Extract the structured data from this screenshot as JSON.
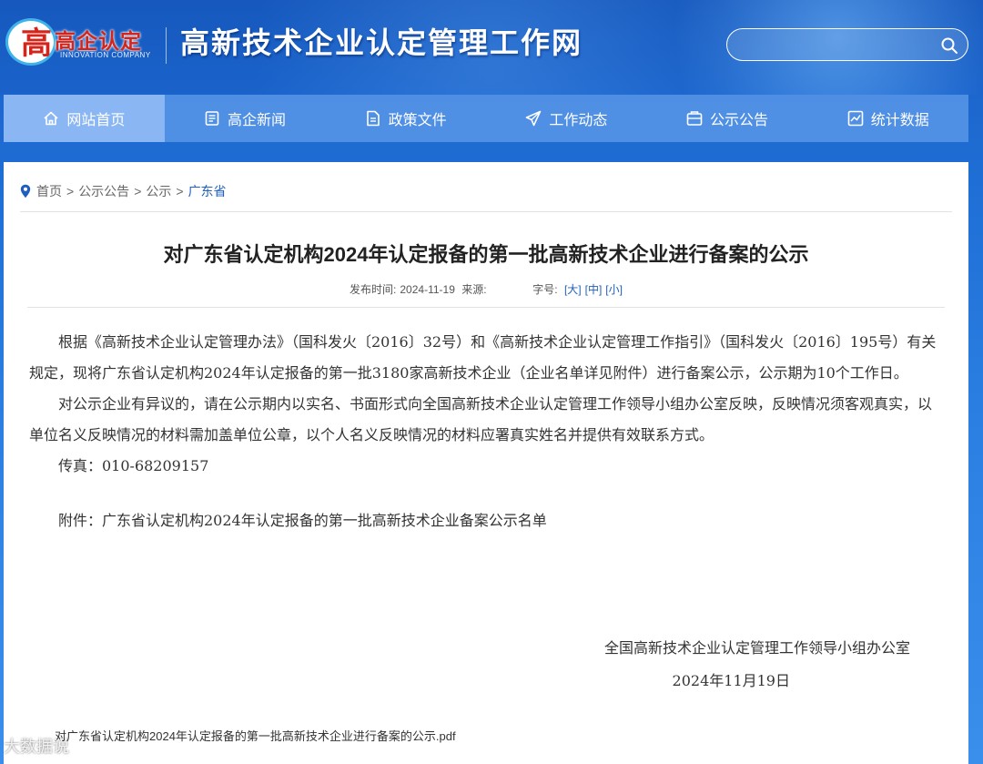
{
  "logo": {
    "cn": "高企认定",
    "en": "INNOVATION COMPANY",
    "mark": "高"
  },
  "site_title": "高新技术企业认定管理工作网",
  "search": {
    "placeholder": ""
  },
  "nav": [
    {
      "label": "网站首页",
      "icon": "home-icon"
    },
    {
      "label": "高企新闻",
      "icon": "news-icon"
    },
    {
      "label": "政策文件",
      "icon": "document-icon"
    },
    {
      "label": "工作动态",
      "icon": "send-icon"
    },
    {
      "label": "公示公告",
      "icon": "notice-icon"
    },
    {
      "label": "统计数据",
      "icon": "chart-icon"
    }
  ],
  "breadcrumb": {
    "home": "首页",
    "level1": "公示公告",
    "level2": "公示",
    "current": "广东省",
    "sep": ">"
  },
  "article": {
    "title": "对广东省认定机构2024年认定报备的第一批高新技术企业进行备案的公示",
    "publish_label": "发布时间:",
    "publish_date": "2024-11-19",
    "source_label": "来源:",
    "font_label": "字号:",
    "font_large": "[大]",
    "font_medium": "[中]",
    "font_small": "[小]",
    "paragraphs": [
      "根据《高新技术企业认定管理办法》（国科发火〔2016〕32号）和《高新技术企业认定管理工作指引》（国科发火〔2016〕195号）有关规定，现将广东省认定机构2024年认定报备的第一批3180家高新技术企业（企业名单详见附件）进行备案公示，公示期为10个工作日。",
      "对公示企业有异议的，请在公示期内以实名、书面形式向全国高新技术企业认定管理工作领导小组办公室反映，反映情况须客观真实，以单位名义反映情况的材料需加盖单位公章，以个人名义反映情况的材料应署真实姓名并提供有效联系方式。",
      "传真：010-68209157"
    ],
    "attachment_note": "附件：广东省认定机构2024年认定报备的第一批高新技术企业备案公示名单",
    "signature": "全国高新技术企业认定管理工作领导小组办公室",
    "signature_date": "2024年11月19日",
    "attachment_file": "对广东省认定机构2024年认定报备的第一批高新技术企业进行备案的公示.pdf"
  },
  "watermark": "大数据说"
}
